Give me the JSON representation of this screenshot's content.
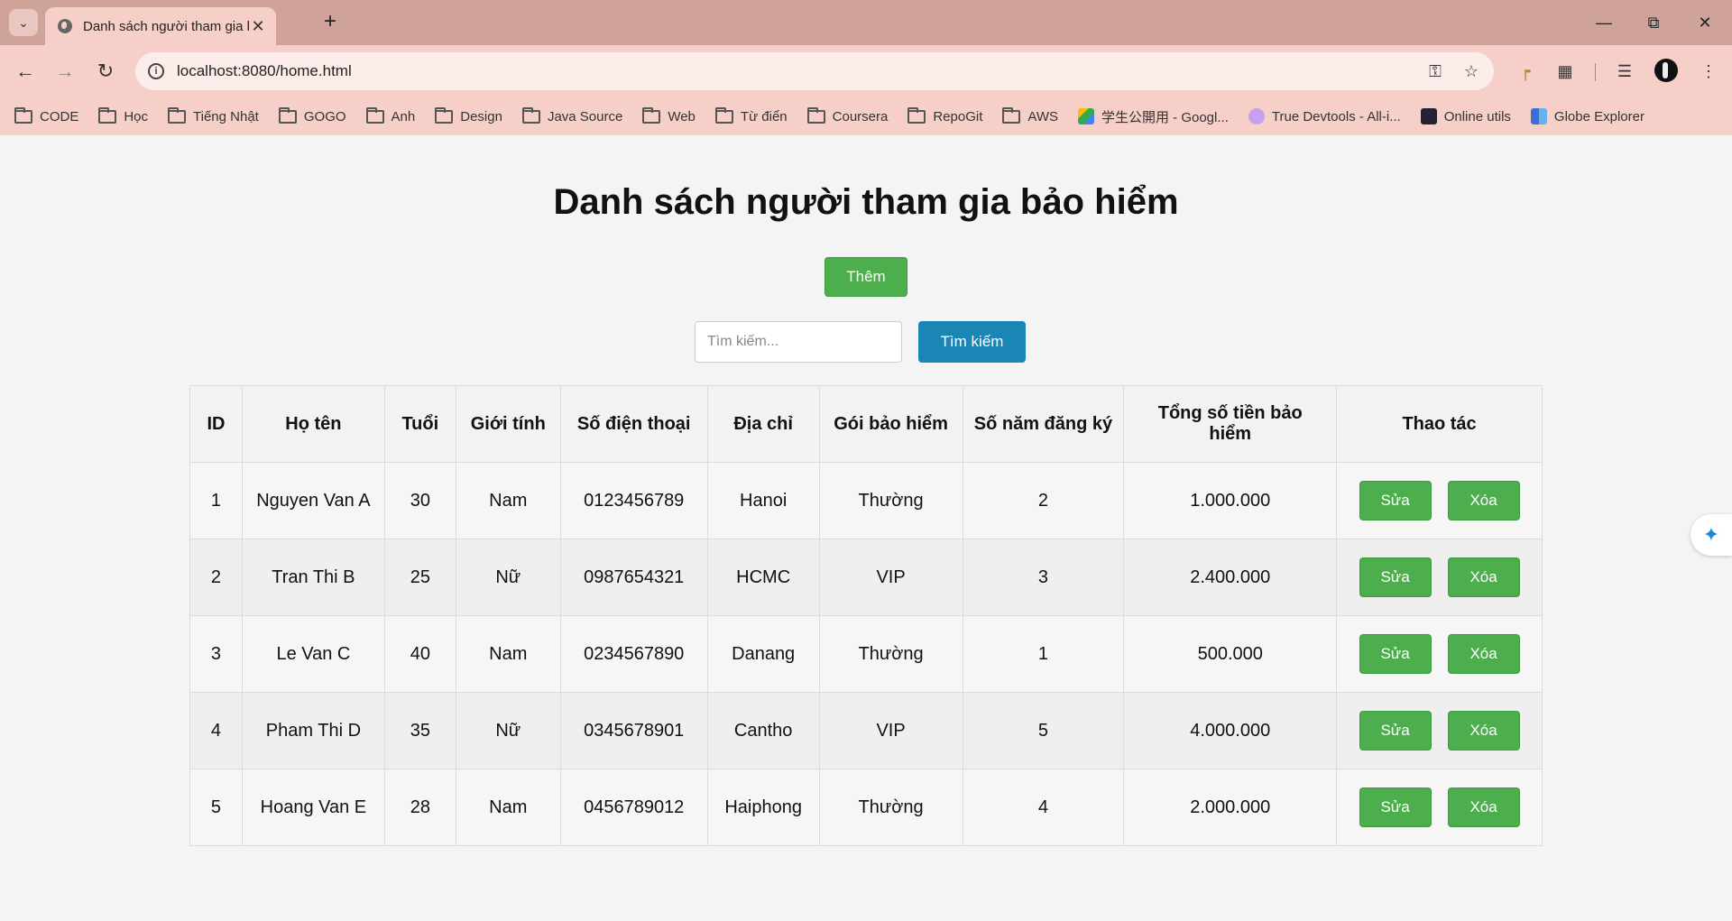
{
  "browser": {
    "tab_title": "Danh sách người tham gia bảo",
    "url": "localhost:8080/home.html",
    "bookmarks": [
      "CODE",
      "Học",
      "Tiếng Nhật",
      "GOGO",
      "Anh",
      "Design",
      "Java Source",
      "Web",
      "Từ điển",
      "Coursera",
      "RepoGit",
      "AWS",
      "学生公開用 - Googl...",
      "True Devtools - All-i...",
      "Online utils",
      "Globe Explorer"
    ]
  },
  "page": {
    "title": "Danh sách người tham gia bảo hiểm",
    "add_label": "Thêm",
    "search_placeholder": "Tìm kiếm...",
    "search_label": "Tìm kiếm"
  },
  "table": {
    "headers": [
      "ID",
      "Họ tên",
      "Tuổi",
      "Giới tính",
      "Số điện thoại",
      "Địa chỉ",
      "Gói bảo hiểm",
      "Số năm đăng ký",
      "Tổng số tiền bảo hiểm",
      "Thao tác"
    ],
    "edit_label": "Sửa",
    "delete_label": "Xóa",
    "rows": [
      [
        "1",
        "Nguyen Van A",
        "30",
        "Nam",
        "0123456789",
        "Hanoi",
        "Thường",
        "2",
        "1.000.000"
      ],
      [
        "2",
        "Tran Thi B",
        "25",
        "Nữ",
        "0987654321",
        "HCMC",
        "VIP",
        "3",
        "2.400.000"
      ],
      [
        "3",
        "Le Van C",
        "40",
        "Nam",
        "0234567890",
        "Danang",
        "Thường",
        "1",
        "500.000"
      ],
      [
        "4",
        "Pham Thi D",
        "35",
        "Nữ",
        "0345678901",
        "Cantho",
        "VIP",
        "5",
        "4.000.000"
      ],
      [
        "5",
        "Hoang Van E",
        "28",
        "Nam",
        "0456789012",
        "Haiphong",
        "Thường",
        "4",
        "2.000.000"
      ]
    ]
  },
  "colors": {
    "chrome": "#cfa39a",
    "toolbar": "#f5cfc8",
    "green_button": "#4cae4c",
    "blue_button": "#1a86b6"
  }
}
